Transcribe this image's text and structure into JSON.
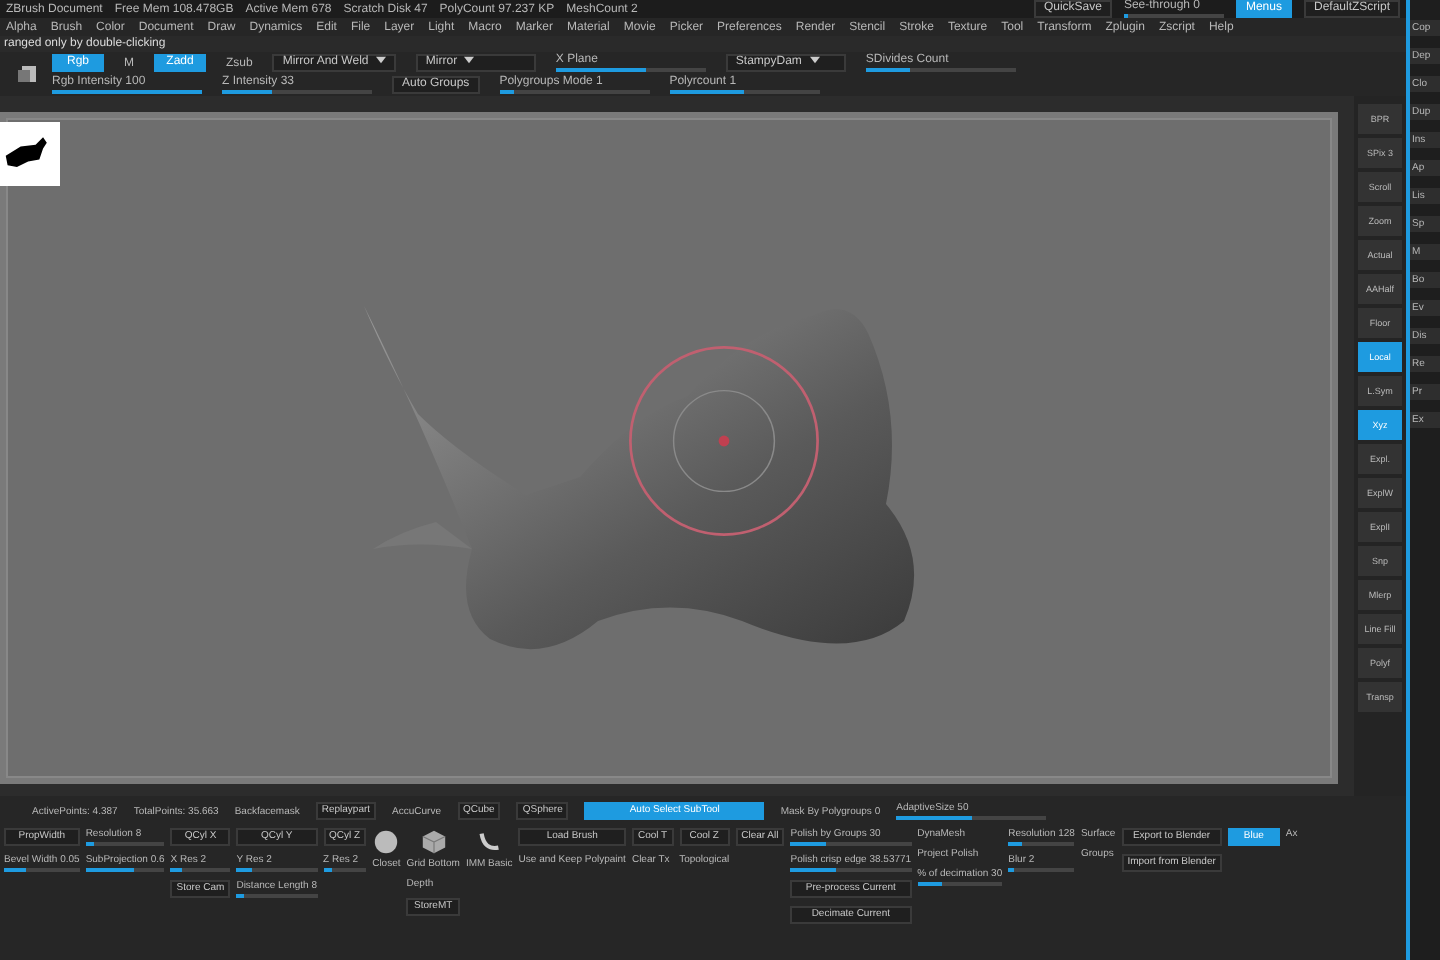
{
  "title_bar": {
    "items": [
      "ZBrush Document",
      "Free Mem 108.478GB",
      "Active Mem 678",
      "Scratch Disk 47",
      "PolyCount 97.237 KP",
      "MeshCount 2"
    ],
    "quicksave": "QuickSave",
    "see_through": {
      "label": "See-through 0",
      "level": 0.05
    },
    "menus": {
      "label": "Menus",
      "selected": true
    },
    "script": "DefaultZScript"
  },
  "menu_bar": [
    "Alpha",
    "Brush",
    "Color",
    "Document",
    "Draw",
    "Dynamics",
    "Edit",
    "File",
    "Layer",
    "Light",
    "Macro",
    "Marker",
    "Material",
    "Movie",
    "Picker",
    "Preferences",
    "Render",
    "Stencil",
    "Stroke",
    "Texture",
    "Tool",
    "Transform",
    "Zplugin",
    "Zscript",
    "Help"
  ],
  "notice": "ranged only by double-clicking",
  "toolbar": {
    "row1": [
      {
        "kind": "toggle",
        "label": "Rgb",
        "selected": true
      },
      {
        "kind": "text",
        "label": "M"
      },
      {
        "kind": "toggle",
        "label": "Zadd",
        "selected": true
      },
      {
        "kind": "text",
        "label": "Zsub"
      },
      {
        "kind": "dropdown",
        "label": "Mirror And Weld"
      },
      {
        "kind": "dropdown",
        "label": "Mirror"
      },
      {
        "kind": "slider",
        "label": "X Plane",
        "level": 0.6
      },
      {
        "kind": "dropdown",
        "label": "StampyDam"
      },
      {
        "kind": "slider",
        "label": "SDivides Count",
        "level": 0.3
      }
    ],
    "row2": [
      {
        "kind": "slider",
        "label": "Rgb Intensity 100",
        "level": 1
      },
      {
        "kind": "slider",
        "label": "Z Intensity 33",
        "level": 0.33
      },
      {
        "kind": "button",
        "label": "Auto Groups"
      },
      {
        "kind": "slider",
        "label": "Polygroups Mode 1",
        "level": 0.1
      },
      {
        "kind": "slider",
        "label": "Polyrcount 1",
        "level": 0.5
      }
    ]
  },
  "shelf": [
    {
      "label": "BPR",
      "selected": false
    },
    {
      "label": "SPix 3",
      "selected": false
    },
    {
      "label": "Scroll",
      "selected": false
    },
    {
      "label": "Zoom",
      "selected": false
    },
    {
      "label": "Actual",
      "selected": false
    },
    {
      "label": "AAHalf",
      "selected": false
    },
    {
      "label": "Floor",
      "selected": false
    },
    {
      "label": "Local",
      "selected": true
    },
    {
      "label": "L.Sym",
      "selected": false
    },
    {
      "label": "Xyz",
      "selected": true
    },
    {
      "label": "Expl.",
      "selected": false
    },
    {
      "label": "ExplW",
      "selected": false
    },
    {
      "label": "ExplI",
      "selected": false
    },
    {
      "label": "Snp",
      "selected": false
    },
    {
      "label": "Mlerp",
      "selected": false
    },
    {
      "label": "Line Fill",
      "selected": false
    },
    {
      "label": "Polyf",
      "selected": false
    },
    {
      "label": "Transp",
      "selected": false
    }
  ],
  "right_panel": [
    "Cop",
    "Dep",
    "Clo",
    "Dup",
    "Ins",
    "Ap",
    "Lis",
    "Sp",
    "M",
    "Bo",
    "Ev",
    "Dis",
    "Re",
    "Pr",
    "Ex"
  ],
  "bottom": {
    "stats": [
      {
        "kind": "text",
        "label": "ActivePoints: 4.387"
      },
      {
        "kind": "text",
        "label": "TotalPoints: 35.663"
      },
      {
        "kind": "text",
        "label": "Backfacemask"
      },
      {
        "kind": "button",
        "label": "Replaypart"
      },
      {
        "kind": "text",
        "label": "AccuCurve"
      },
      {
        "kind": "button",
        "label": "QCube"
      },
      {
        "kind": "button",
        "label": "QSphere"
      },
      {
        "kind": "toggle",
        "label": "Auto Select SubTool",
        "selected": true
      },
      {
        "kind": "text",
        "label": "Mask By Polygroups 0"
      },
      {
        "kind": "slider",
        "label": "AdaptiveSize 50",
        "level": 0.5
      }
    ],
    "columns": [
      [
        {
          "kind": "button",
          "label": "PropWidth"
        },
        {
          "kind": "slider",
          "label": "Bevel Width 0.05",
          "level": 0.3
        }
      ],
      [
        {
          "kind": "slider",
          "label": "Resolution 8",
          "level": 0.1
        },
        {
          "kind": "slider",
          "label": "SubProjection 0.6",
          "level": 0.6
        }
      ],
      [
        {
          "kind": "button",
          "label": "QCyl X"
        },
        {
          "kind": "slider",
          "label": "X Res 2",
          "level": 0.2
        },
        {
          "kind": "button",
          "label": "Store Cam"
        }
      ],
      [
        {
          "kind": "button",
          "label": "QCyl Y"
        },
        {
          "kind": "slider",
          "label": "Y Res 2",
          "level": 0.2
        },
        {
          "kind": "slider",
          "label": "Distance Length 8",
          "level": 0.1
        }
      ],
      [
        {
          "kind": "button",
          "label": "QCyl Z"
        },
        {
          "kind": "slider",
          "label": "Z Res 2",
          "level": 0.2
        }
      ],
      [
        {
          "kind": "sphere",
          "label": "Closet"
        }
      ],
      [
        {
          "kind": "cube",
          "label": "Grid Bottom"
        },
        {
          "kind": "text",
          "label": "Depth"
        },
        {
          "kind": "button",
          "label": "StoreMT"
        }
      ],
      [
        {
          "kind": "arc",
          "label": "IMM Basic"
        }
      ],
      [
        {
          "kind": "button",
          "label": "Load Brush"
        },
        {
          "kind": "text",
          "label": "Use and Keep Polypaint"
        }
      ],
      [
        {
          "kind": "button",
          "label": "Cool T"
        },
        {
          "kind": "text",
          "label": "Clear Tx"
        }
      ],
      [
        {
          "kind": "button",
          "label": "Cool Z"
        },
        {
          "kind": "text",
          "label": "Topological"
        }
      ],
      [
        {
          "kind": "button",
          "label": "Clear All"
        }
      ],
      [
        {
          "kind": "slider",
          "label": "Polish by Groups 30",
          "level": 0.3
        },
        {
          "kind": "slider",
          "label": "Polish crisp edge 38.53771",
          "level": 0.38
        },
        {
          "kind": "button",
          "label": "Pre-process Current"
        },
        {
          "kind": "button",
          "label": "Decimate Current"
        }
      ],
      [
        {
          "kind": "text",
          "label": "DynaMesh"
        },
        {
          "kind": "text",
          "label": "Project Polish"
        },
        {
          "kind": "slider",
          "label": "% of decimation 30",
          "level": 0.3
        }
      ],
      [
        {
          "kind": "slider",
          "label": "Resolution 128",
          "level": 0.2
        },
        {
          "kind": "slider",
          "label": "Blur 2",
          "level": 0.1
        }
      ],
      [
        {
          "kind": "text",
          "label": "Surface"
        },
        {
          "kind": "text",
          "label": "Groups"
        }
      ],
      [
        {
          "kind": "button",
          "label": "Export to Blender"
        },
        {
          "kind": "button",
          "label": "Import from Blender"
        }
      ],
      [
        {
          "kind": "toggle",
          "label": "Blue",
          "selected": true
        }
      ],
      [
        {
          "kind": "text",
          "label": "Ax"
        }
      ]
    ]
  }
}
